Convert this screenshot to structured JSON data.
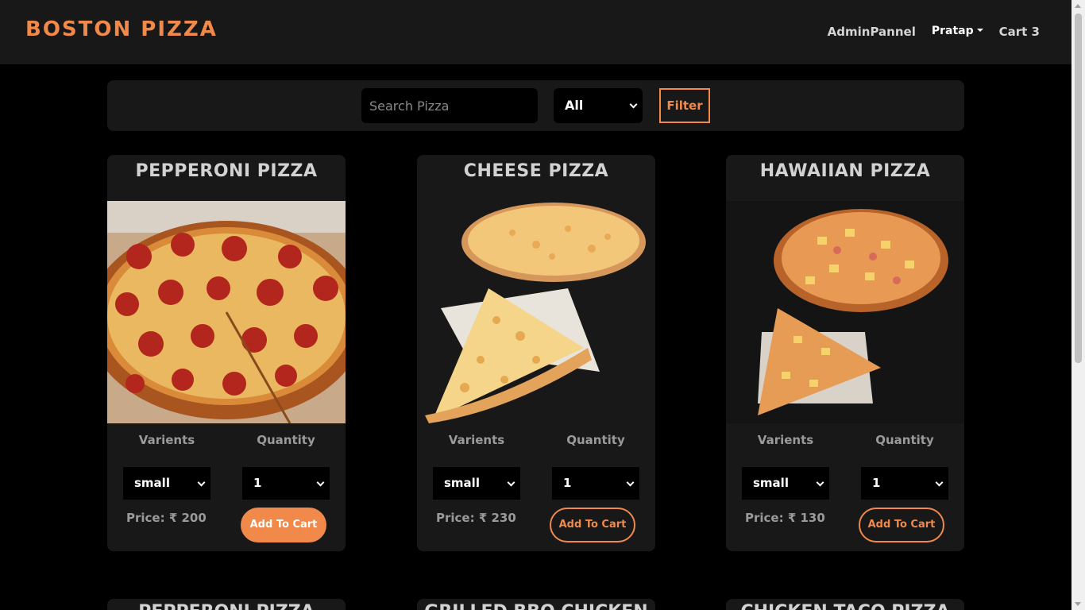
{
  "brand": "BOSTON PIZZA",
  "nav": {
    "admin": "AdminPannel",
    "user": "Pratap",
    "cart": "Cart 3"
  },
  "filter": {
    "search_placeholder": "Search Pizza",
    "category": "All",
    "button": "Filter"
  },
  "labels": {
    "variants": "Varients",
    "quantity": "Quantity",
    "add_to_cart": "Add To Cart"
  },
  "pizzas": [
    {
      "name": "PEPPERONI PIZZA",
      "variant": "small",
      "quantity": "1",
      "price": "Price: ₹ 200"
    },
    {
      "name": "CHEESE PIZZA",
      "variant": "small",
      "quantity": "1",
      "price": "Price: ₹ 230"
    },
    {
      "name": "HAWAIIAN PIZZA",
      "variant": "small",
      "quantity": "1",
      "price": "Price: ₹ 130"
    }
  ],
  "next_row": [
    {
      "name": "PEPPERONI PIZZA"
    },
    {
      "name": "GRILLED BBQ CHICKEN"
    },
    {
      "name": "CHICKEN TACO PIZZA"
    }
  ],
  "colors": {
    "accent": "#f0894a",
    "panel": "#181818",
    "background": "#000000"
  }
}
